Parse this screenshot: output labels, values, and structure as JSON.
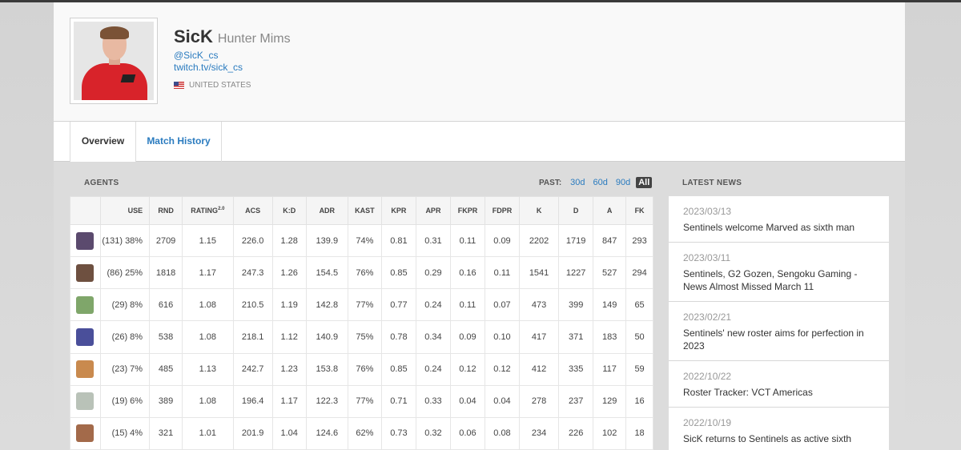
{
  "player": {
    "handle": "SicK",
    "real_name": "Hunter Mims",
    "twitter": "@SicK_cs",
    "twitch": "twitch.tv/sick_cs",
    "country": "UNITED STATES"
  },
  "tabs": [
    {
      "label": "Overview",
      "active": true
    },
    {
      "label": "Match History",
      "active": false
    }
  ],
  "agents": {
    "title": "AGENTS",
    "past_label": "PAST:",
    "past_options": [
      "30d",
      "60d",
      "90d",
      "All"
    ],
    "past_selected": "All",
    "columns": [
      "",
      "USE",
      "RND",
      "RATING",
      "ACS",
      "K:D",
      "ADR",
      "KAST",
      "KPR",
      "APR",
      "FKPR",
      "FDPR",
      "K",
      "D",
      "A",
      "FK"
    ],
    "rating_sup": "2.0",
    "rows": [
      {
        "icon": "agent-1-icon",
        "color": "#5b4a6e",
        "cells": [
          "(131) 38%",
          "2709",
          "1.15",
          "226.0",
          "1.28",
          "139.9",
          "74%",
          "0.81",
          "0.31",
          "0.11",
          "0.09",
          "2202",
          "1719",
          "847",
          "293"
        ]
      },
      {
        "icon": "agent-2-icon",
        "color": "#6e5040",
        "cells": [
          "(86) 25%",
          "1818",
          "1.17",
          "247.3",
          "1.26",
          "154.5",
          "76%",
          "0.85",
          "0.29",
          "0.16",
          "0.11",
          "1541",
          "1227",
          "527",
          "294"
        ]
      },
      {
        "icon": "agent-3-icon",
        "color": "#7fa66a",
        "cells": [
          "(29) 8%",
          "616",
          "1.08",
          "210.5",
          "1.19",
          "142.8",
          "77%",
          "0.77",
          "0.24",
          "0.11",
          "0.07",
          "473",
          "399",
          "149",
          "65"
        ]
      },
      {
        "icon": "agent-4-icon",
        "color": "#4a4f9a",
        "cells": [
          "(26) 8%",
          "538",
          "1.08",
          "218.1",
          "1.12",
          "140.9",
          "75%",
          "0.78",
          "0.34",
          "0.09",
          "0.10",
          "417",
          "371",
          "183",
          "50"
        ]
      },
      {
        "icon": "agent-5-icon",
        "color": "#c98a4e",
        "cells": [
          "(23) 7%",
          "485",
          "1.13",
          "242.7",
          "1.23",
          "153.8",
          "76%",
          "0.85",
          "0.24",
          "0.12",
          "0.12",
          "412",
          "335",
          "117",
          "59"
        ]
      },
      {
        "icon": "agent-6-icon",
        "color": "#b9c2b8",
        "cells": [
          "(19) 6%",
          "389",
          "1.08",
          "196.4",
          "1.17",
          "122.3",
          "77%",
          "0.71",
          "0.33",
          "0.04",
          "0.04",
          "278",
          "237",
          "129",
          "16"
        ]
      },
      {
        "icon": "agent-7-icon",
        "color": "#a36a4a",
        "cells": [
          "(15) 4%",
          "321",
          "1.01",
          "201.9",
          "1.04",
          "124.6",
          "62%",
          "0.73",
          "0.32",
          "0.06",
          "0.08",
          "234",
          "226",
          "102",
          "18"
        ]
      }
    ]
  },
  "news": {
    "title": "LATEST NEWS",
    "items": [
      {
        "date": "2023/03/13",
        "title": "Sentinels welcome Marved as sixth man"
      },
      {
        "date": "2023/03/11",
        "title": "Sentinels, G2 Gozen, Sengoku Gaming - News Almost Missed March 11"
      },
      {
        "date": "2023/02/21",
        "title": "Sentinels' new roster aims for perfection in 2023"
      },
      {
        "date": "2022/10/22",
        "title": "Roster Tracker: VCT Americas"
      },
      {
        "date": "2022/10/19",
        "title": "SicK returns to Sentinels as active sixth"
      }
    ]
  }
}
